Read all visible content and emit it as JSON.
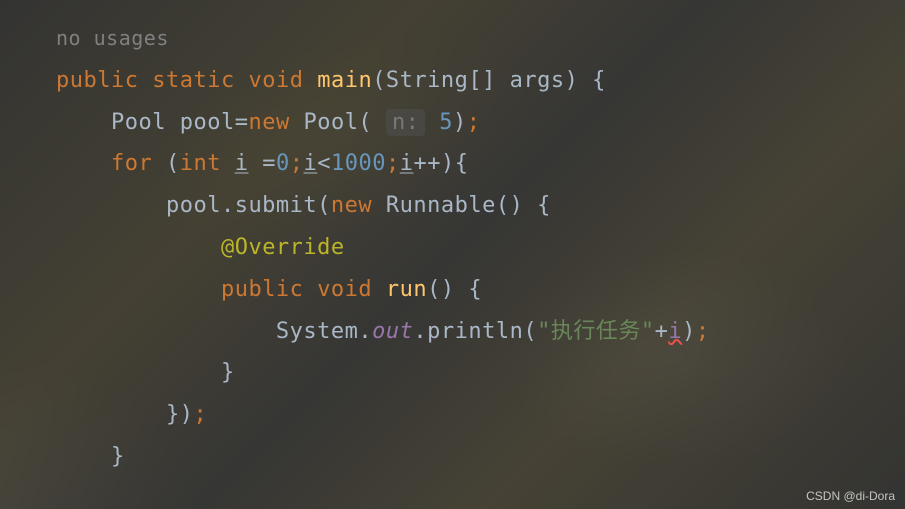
{
  "hint": "no usages",
  "line1": {
    "kw_public": "public",
    "kw_static": "static",
    "kw_void": "void",
    "method": "main",
    "params_open": "(String[] args) {"
  },
  "line2": {
    "type": "Pool",
    "var": "pool=",
    "kw_new": "new",
    "ctor": "Pool(",
    "param_hint": "n:",
    "value": "5",
    "close": ")",
    "semi": ";"
  },
  "line3": {
    "kw_for": "for",
    "open": " (",
    "kw_int": "int",
    "var_i": "i",
    "eq": " =",
    "zero": "0",
    "semi1": ";",
    "i2": "i",
    "lt": "<",
    "thousand": "1000",
    "semi2": ";",
    "i3": "i",
    "inc": "++){"
  },
  "line4": {
    "call": "pool.submit(",
    "kw_new": "new",
    "runnable": "Runnable() {"
  },
  "line5": {
    "annotation": "@Override"
  },
  "line6": {
    "kw_public": "public",
    "kw_void": "void",
    "method": "run",
    "parens": "() {"
  },
  "line7": {
    "system": "System.",
    "out": "out",
    "println": ".println(",
    "string": "\"执行任务\"",
    "plus": "+",
    "i": "i",
    "close": ")",
    "semi": ";"
  },
  "line8": {
    "brace": "}"
  },
  "line9": {
    "brace": "})",
    "semi": ";"
  },
  "line10": {
    "brace": "}"
  },
  "watermark": "CSDN @di-Dora"
}
